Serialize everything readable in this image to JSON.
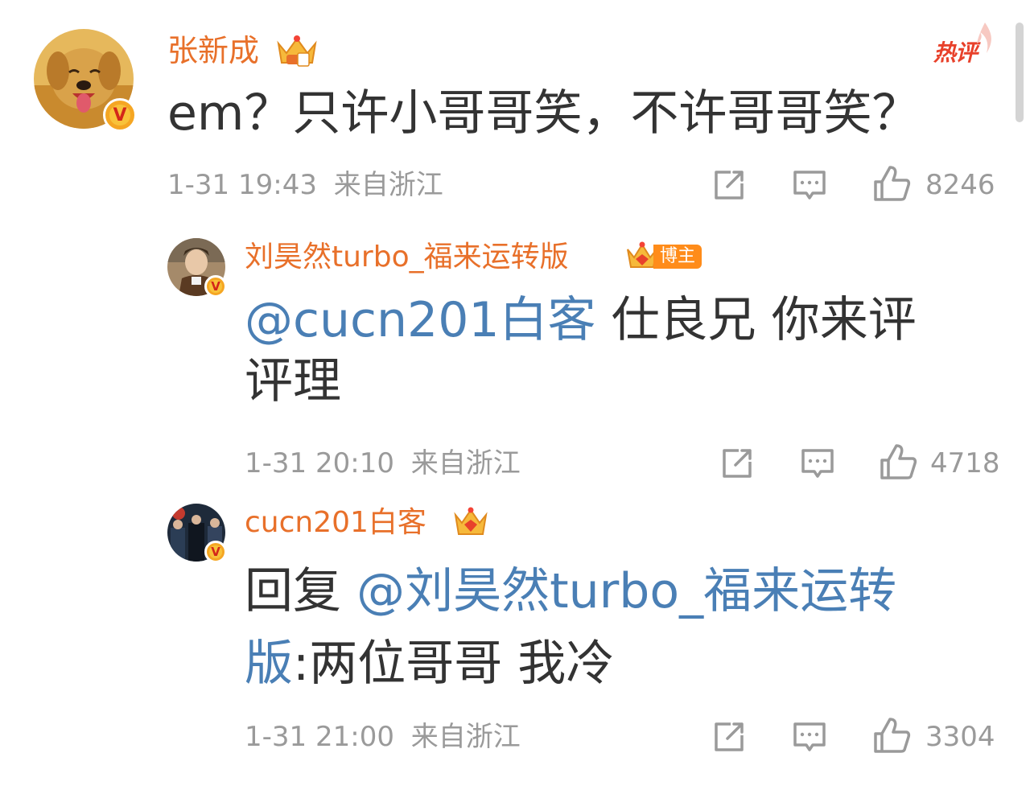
{
  "comments": [
    {
      "username": "张新成",
      "text": "em？只许小哥哥笑，不许哥哥笑？",
      "time": "1-31 19:43",
      "location": "来自浙江",
      "likes": "8246",
      "hot_label": "热评"
    },
    {
      "username": "刘昊然turbo_福来运转版",
      "badge": "博主",
      "mention": "@cucn201白客",
      "text_line1": " 仕良兄 你来评",
      "text_line2": "评理",
      "time": "1-31 20:10",
      "location": "来自浙江",
      "likes": "4718"
    },
    {
      "username": "cucn201白客",
      "prefix": "回复 ",
      "mention_line1": "@刘昊然turbo_福来运转",
      "mention_line2": "版",
      "text_line2": ":两位哥哥 我冷",
      "time": "1-31 21:00",
      "location": "来自浙江",
      "likes": "3304"
    }
  ],
  "colors": {
    "username": "#e8702a",
    "mention": "#4a7fb5",
    "meta": "#9a9a9a",
    "hot": "#e8412b"
  },
  "icons": [
    "share-icon",
    "comment-icon",
    "like-icon",
    "crown-icon",
    "verified-badge-icon"
  ]
}
